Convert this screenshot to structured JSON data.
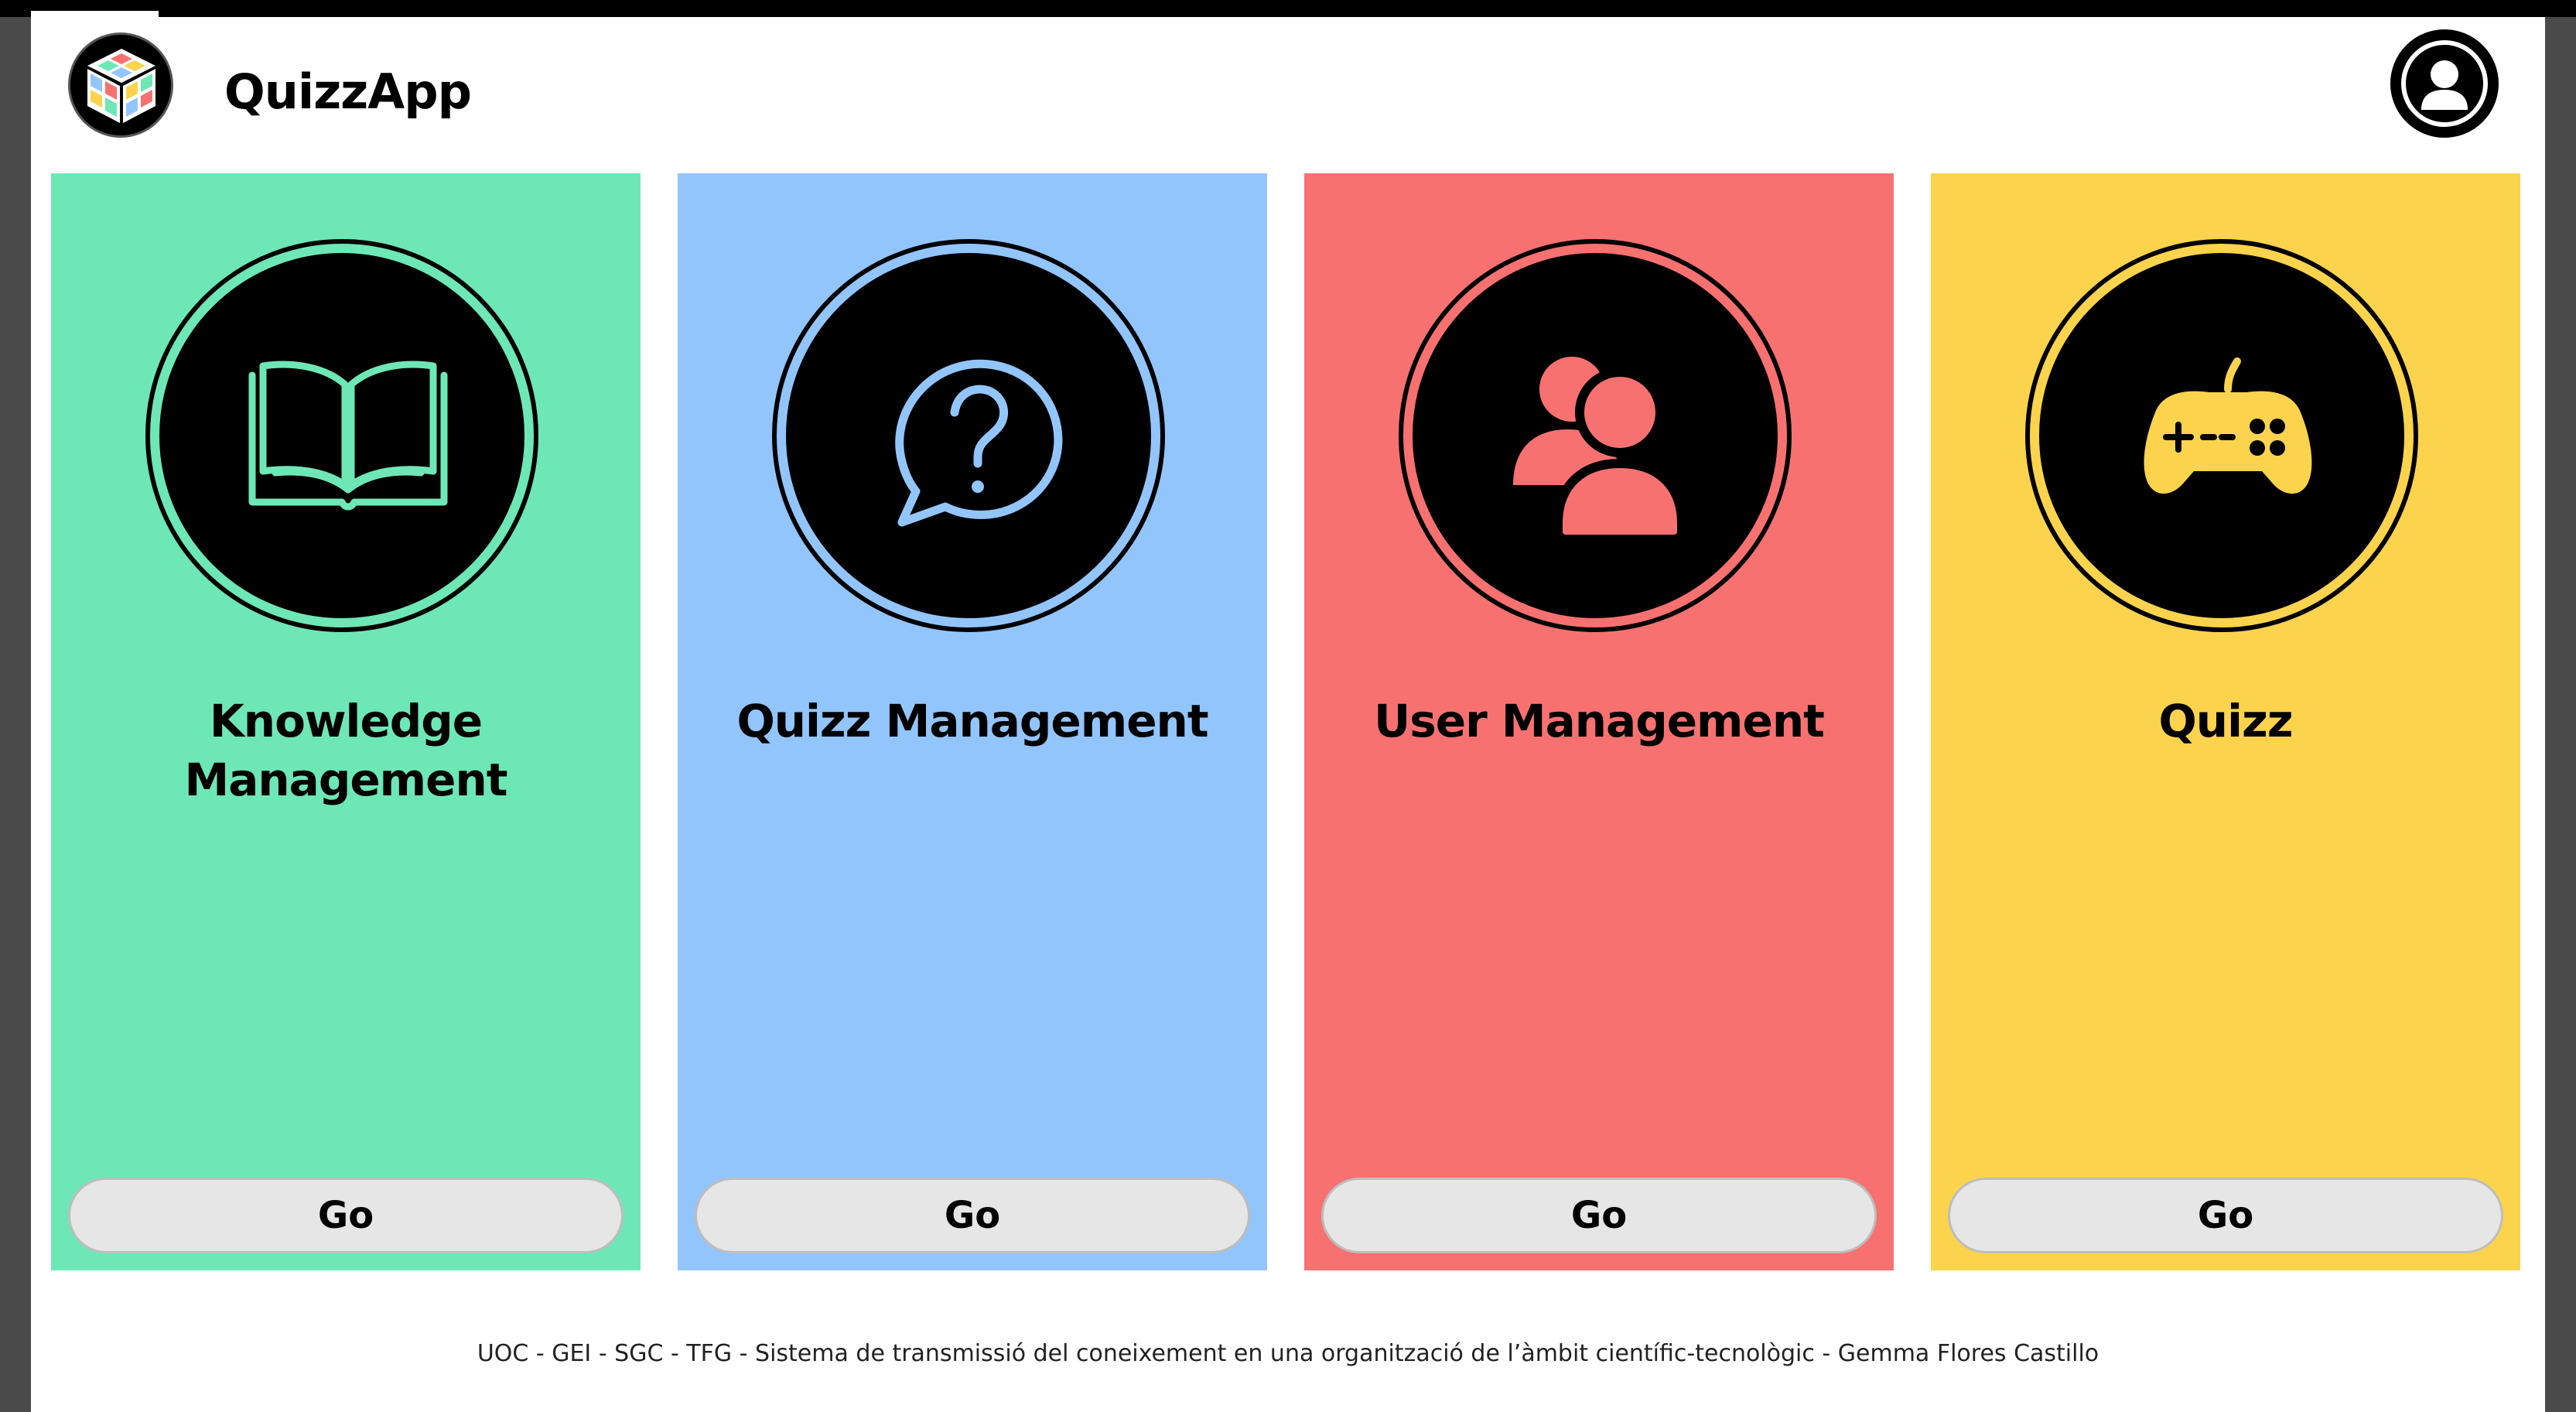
{
  "app": {
    "title": "QuizzApp",
    "logo_icon": "rubiks-cube-icon",
    "user_icon": "user-account-icon"
  },
  "cards": [
    {
      "title_line1": "Knowledge",
      "title_line2": "Management",
      "icon": "open-book-icon",
      "color": "#6ee7b7",
      "button_label": "Go"
    },
    {
      "title_line1": "Quizz Management",
      "title_line2": "",
      "icon": "question-bubble-icon",
      "color": "#93c5fd",
      "button_label": "Go"
    },
    {
      "title_line1": "User Management",
      "title_line2": "",
      "icon": "users-icon",
      "color": "#f87171",
      "button_label": "Go"
    },
    {
      "title_line1": "Quizz",
      "title_line2": "",
      "icon": "gamepad-icon",
      "color": "#fcd34d",
      "button_label": "Go"
    }
  ],
  "footer": {
    "text": "UOC - GEI - SGC - TFG - Sistema de transmissió del coneixement en una organització de l’àmbit científic-tecnològic - Gemma Flores Castillo"
  }
}
